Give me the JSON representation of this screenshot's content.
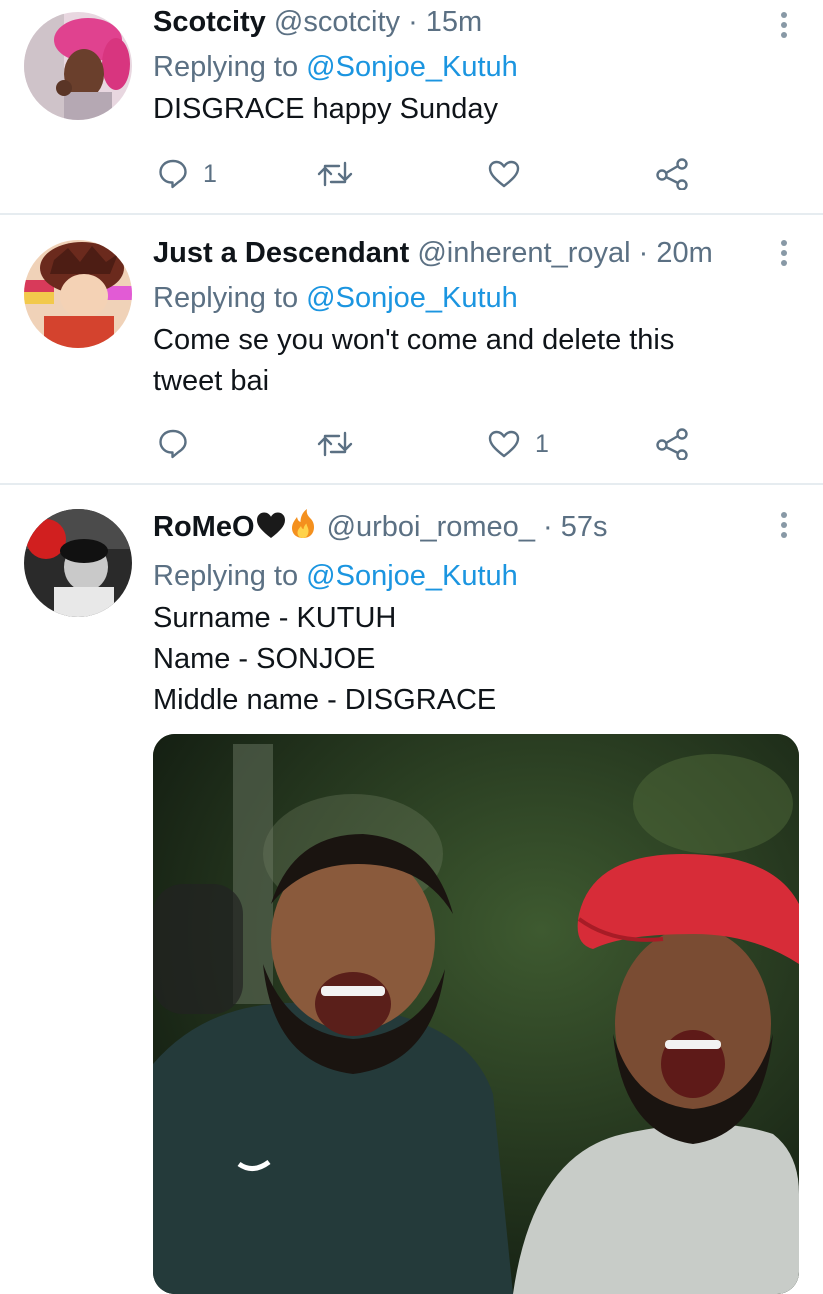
{
  "tweets": [
    {
      "display_name": "Scotcity",
      "handle": "@scotcity",
      "time": "15m",
      "replying_prefix": "Replying to ",
      "replying_to": "@Sonjoe_Kutuh",
      "text": "DISGRACE happy Sunday",
      "reply_count": "1",
      "retweet_count": "",
      "like_count": ""
    },
    {
      "display_name": "Just a Descendant",
      "handle": "@inherent_royal",
      "time": "20m",
      "replying_prefix": "Replying to ",
      "replying_to": "@Sonjoe_Kutuh",
      "text": "Come se you won't come and delete this\ntweet bai",
      "reply_count": "",
      "retweet_count": "",
      "like_count": "1"
    },
    {
      "display_name": "RoMeO",
      "display_name_emojis": [
        "black-heart",
        "fire"
      ],
      "handle": "@urboi_romeo_",
      "time": "57s",
      "replying_prefix": "Replying to ",
      "replying_to": "@Sonjoe_Kutuh",
      "text": "Surname - KUTUH\nName - SONJOE\nMiddle name - DISGRACE",
      "media": "photo-two-men-laughing"
    }
  ],
  "separator": " · ",
  "icons": [
    "reply-icon",
    "retweet-icon",
    "like-icon",
    "share-icon",
    "more-icon"
  ],
  "colors": {
    "link": "#1b95e0",
    "secondary": "#5b7083",
    "text": "#0f1419",
    "divider": "#e6ecf0"
  }
}
